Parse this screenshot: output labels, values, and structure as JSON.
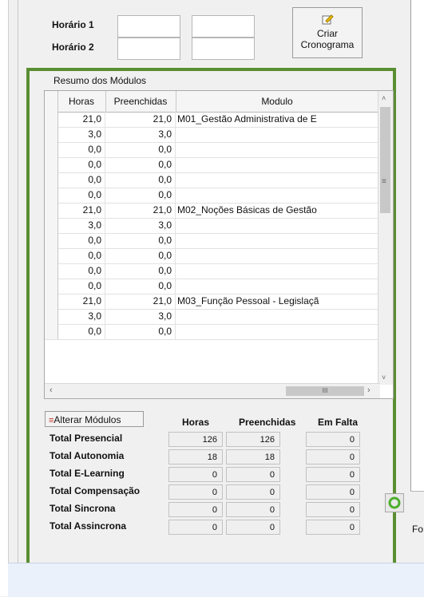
{
  "schedule": {
    "h1_label": "Horário 1",
    "h2_label": "Horário 2",
    "create_button": "Criar Cronograma"
  },
  "summary": {
    "title": "Resumo dos Módulos",
    "columns": [
      "Horas",
      "Preenchidas",
      "Modulo"
    ],
    "rows": [
      [
        "21,0",
        "21,0",
        "M01_Gestão Administrativa de E"
      ],
      [
        "3,0",
        "3,0",
        ""
      ],
      [
        "0,0",
        "0,0",
        ""
      ],
      [
        "0,0",
        "0,0",
        ""
      ],
      [
        "0,0",
        "0,0",
        ""
      ],
      [
        "0,0",
        "0,0",
        ""
      ],
      [
        "21,0",
        "21,0",
        "M02_Noções Básicas de Gestão"
      ],
      [
        "3,0",
        "3,0",
        ""
      ],
      [
        "0,0",
        "0,0",
        ""
      ],
      [
        "0,0",
        "0,0",
        ""
      ],
      [
        "0,0",
        "0,0",
        ""
      ],
      [
        "0,0",
        "0,0",
        ""
      ],
      [
        "21,0",
        "21,0",
        "M03_Função Pessoal - Legislaçã"
      ],
      [
        "3,0",
        "3,0",
        ""
      ],
      [
        "0,0",
        "0,0",
        ""
      ]
    ],
    "hscroll_thumb": "III"
  },
  "totals": {
    "alter_button": "Alterar Módulos",
    "headers": [
      "Horas",
      "Preenchidas",
      "Em Falta"
    ],
    "rows": [
      {
        "label": "Total Presencial",
        "values": [
          "126",
          "126",
          "0"
        ]
      },
      {
        "label": "Total Autonomia",
        "values": [
          "18",
          "18",
          "0"
        ]
      },
      {
        "label": "Total E-Learning",
        "values": [
          "0",
          "0",
          "0"
        ]
      },
      {
        "label": "Total Compensação",
        "values": [
          "0",
          "0",
          "0"
        ]
      },
      {
        "label": "Total Sincrona",
        "values": [
          "0",
          "0",
          "0"
        ]
      },
      {
        "label": "Total Assincrona",
        "values": [
          "0",
          "0",
          "0"
        ]
      }
    ]
  },
  "side_label": "Fo"
}
